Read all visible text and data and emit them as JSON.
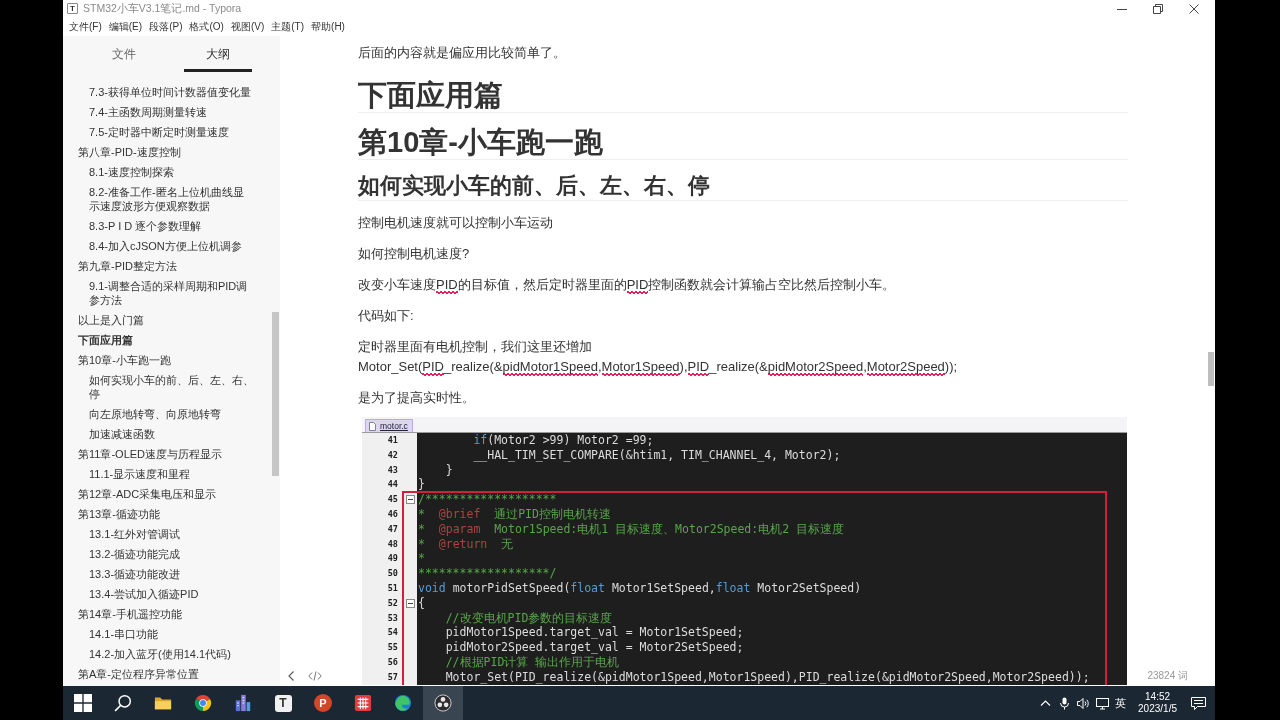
{
  "window": {
    "icon": "T",
    "title": "STM32小车V3.1笔记.md - Typora"
  },
  "menu": [
    "文件(F)",
    "编辑(E)",
    "段落(P)",
    "格式(O)",
    "视图(V)",
    "主题(T)",
    "帮助(H)"
  ],
  "sidebar": {
    "tabs": [
      {
        "label": "文件",
        "selected": false
      },
      {
        "label": "大纲",
        "selected": true
      }
    ],
    "outline": [
      {
        "children": [
          {
            "title": "7.3-获得单位时间计数器值变化量",
            "selected": false
          },
          {
            "title": "7.4-主函数周期测量转速",
            "selected": false
          },
          {
            "title": "7.5-定时器中断定时测量速度",
            "selected": false
          }
        ]
      },
      {
        "title": "第八章-PID-速度控制",
        "selected": false,
        "children": [
          {
            "title": "8.1-速度控制探索",
            "selected": false
          },
          {
            "title": "8.2-准备工作-匿名上位机曲线显示速度波形方便观察数据",
            "selected": false
          },
          {
            "title": "8.3-P I D 逐个参数理解",
            "selected": false
          },
          {
            "title": "8.4-加入cJSON方便上位机调参",
            "selected": false
          }
        ]
      },
      {
        "title": "第九章-PID整定方法",
        "selected": false,
        "children": [
          {
            "title": "9.1-调整合适的采样周期和PID调参方法",
            "selected": false
          }
        ]
      },
      {
        "title": "以上是入门篇",
        "selected": false
      },
      {
        "title": "下面应用篇",
        "selected": true
      },
      {
        "title": "第10章-小车跑一跑",
        "selected": false,
        "children": [
          {
            "title": "如何实现小车的前、后、左、右、停",
            "selected": false
          },
          {
            "title": "向左原地转弯、向原地转弯",
            "selected": false
          },
          {
            "title": "加速减速函数",
            "selected": false
          }
        ]
      },
      {
        "title": "第11章-OLED速度与历程显示",
        "selected": false,
        "children": [
          {
            "title": "11.1-显示速度和里程",
            "selected": false
          }
        ]
      },
      {
        "title": "第12章-ADC采集电压和显示",
        "selected": false
      },
      {
        "title": "第13章-循迹功能",
        "selected": false,
        "children": [
          {
            "title": "13.1-红外对管调试",
            "selected": false
          },
          {
            "title": "13.2-循迹功能完成",
            "selected": false
          },
          {
            "title": "13.3-循迹功能改进",
            "selected": false
          },
          {
            "title": "13.4-尝试加入循迹PID",
            "selected": false
          }
        ]
      },
      {
        "title": "第14章-手机遥控功能",
        "selected": false,
        "children": [
          {
            "title": "14.1-串口功能",
            "selected": false
          },
          {
            "title": "14.2-加入蓝牙(使用14.1代码)",
            "selected": false
          }
        ]
      },
      {
        "title": "第A章-定位程序异常位置",
        "selected": false
      }
    ]
  },
  "document": {
    "blocks": [
      {
        "kind": "paragraph",
        "runs": [
          {
            "text": "后面的内容就是偏应用比较简单了。",
            "misspelled": false
          }
        ]
      },
      {
        "kind": "heading1",
        "text": "下面应用篇"
      },
      {
        "kind": "heading1",
        "text": "第10章-小车跑一跑"
      },
      {
        "kind": "heading2",
        "text": "如何实现小车的前、后、左、右、停"
      },
      {
        "kind": "paragraph",
        "runs": [
          {
            "text": "控制电机速度就可以控制小车运动",
            "misspelled": false
          }
        ]
      },
      {
        "kind": "paragraph",
        "runs": [
          {
            "text": "如何控制电机速度?",
            "misspelled": false
          }
        ]
      },
      {
        "kind": "paragraph",
        "runs": [
          {
            "text": "改变小车速度",
            "misspelled": false
          },
          {
            "text": "PID",
            "misspelled": true
          },
          {
            "text": "的目标值，然后定时器里面的",
            "misspelled": false
          },
          {
            "text": "PID",
            "misspelled": true
          },
          {
            "text": "控制函数就会计算输占空比然后控制小车。",
            "misspelled": false
          }
        ]
      },
      {
        "kind": "paragraph",
        "runs": [
          {
            "text": "代码如下:",
            "misspelled": false
          }
        ]
      },
      {
        "kind": "paragraph",
        "runs": [
          {
            "text": "定时器里面有电机控制，我们这里还增加Motor_Set(",
            "misspelled": false
          },
          {
            "text": "PID",
            "misspelled": true
          },
          {
            "text": "_realize(&",
            "misspelled": false
          },
          {
            "text": "pidMotor1Speed",
            "misspelled": true
          },
          {
            "text": ",",
            "misspelled": false
          },
          {
            "text": "Motor1Speed",
            "misspelled": true
          },
          {
            "text": "),",
            "misspelled": false
          },
          {
            "text": "PID",
            "misspelled": true
          },
          {
            "text": "_realize(&",
            "misspelled": false
          },
          {
            "text": "pidMotor2Speed",
            "misspelled": true
          },
          {
            "text": ",",
            "misspelled": false
          },
          {
            "text": "Motor2Speed",
            "misspelled": true
          },
          {
            "text": "));",
            "misspelled": false
          }
        ]
      },
      {
        "kind": "paragraph",
        "runs": [
          {
            "text": "是为了提高实时性。",
            "misspelled": false
          }
        ]
      },
      {
        "kind": "code_image",
        "tab": "motor.c",
        "lines": [
          {
            "number": "41",
            "fold": false,
            "runs": [
              {
                "kind": "keyword",
                "text": "        if"
              },
              {
                "kind": "plain",
                "text": "(Motor2 >99) Motor2 =99;"
              }
            ]
          },
          {
            "number": "42",
            "fold": false,
            "runs": [
              {
                "kind": "plain",
                "text": "        __HAL_TIM_SET_COMPARE(&htim1, TIM_CHANNEL_4, Motor2);"
              }
            ]
          },
          {
            "number": "43",
            "fold": false,
            "runs": [
              {
                "kind": "plain",
                "text": "    }"
              }
            ]
          },
          {
            "number": "44",
            "fold": false,
            "runs": [
              {
                "kind": "plain",
                "text": "}"
              }
            ]
          },
          {
            "number": "45",
            "fold": true,
            "runs": [
              {
                "kind": "comment",
                "text": "/*******************"
              }
            ]
          },
          {
            "number": "46",
            "fold": false,
            "runs": [
              {
                "kind": "comment",
                "text": "*  "
              },
              {
                "kind": "tag",
                "text": "@brief"
              },
              {
                "kind": "comment",
                "text": "  通过PID控制电机转速"
              }
            ]
          },
          {
            "number": "47",
            "fold": false,
            "runs": [
              {
                "kind": "comment",
                "text": "*  "
              },
              {
                "kind": "tag",
                "text": "@param"
              },
              {
                "kind": "comment",
                "text": "  Motor1Speed:电机1 目标速度、Motor2Speed:电机2 目标速度"
              }
            ]
          },
          {
            "number": "48",
            "fold": false,
            "runs": [
              {
                "kind": "comment",
                "text": "*  "
              },
              {
                "kind": "tag",
                "text": "@return"
              },
              {
                "kind": "comment",
                "text": "  无"
              }
            ]
          },
          {
            "number": "49",
            "fold": false,
            "runs": [
              {
                "kind": "comment",
                "text": "*"
              }
            ]
          },
          {
            "number": "50",
            "fold": false,
            "runs": [
              {
                "kind": "comment",
                "text": "*******************/"
              }
            ]
          },
          {
            "number": "51",
            "fold": false,
            "runs": [
              {
                "kind": "keyword",
                "text": "void"
              },
              {
                "kind": "plain",
                "text": " motorPidSetSpeed("
              },
              {
                "kind": "keyword",
                "text": "float"
              },
              {
                "kind": "plain",
                "text": " Motor1SetSpeed,"
              },
              {
                "kind": "keyword",
                "text": "float"
              },
              {
                "kind": "plain",
                "text": " Motor2SetSpeed)"
              }
            ]
          },
          {
            "number": "52",
            "fold": true,
            "runs": [
              {
                "kind": "plain",
                "text": "{"
              }
            ]
          },
          {
            "number": "53",
            "fold": false,
            "runs": [
              {
                "kind": "comment",
                "text": "    //改变电机PID参数的目标速度"
              }
            ]
          },
          {
            "number": "54",
            "fold": false,
            "runs": [
              {
                "kind": "plain",
                "text": "    pidMotor1Speed.target_val = Motor1SetSpeed;"
              }
            ]
          },
          {
            "number": "55",
            "fold": false,
            "runs": [
              {
                "kind": "plain",
                "text": "    pidMotor2Speed.target_val = Motor2SetSpeed;"
              }
            ]
          },
          {
            "number": "56",
            "fold": false,
            "runs": [
              {
                "kind": "comment",
                "text": "    //根据PID计算 输出作用于电机"
              }
            ]
          },
          {
            "number": "57",
            "fold": false,
            "runs": [
              {
                "kind": "plain",
                "text": "    Motor_Set(PID_realize(&pidMotor1Speed,Motor1Speed),PID_realize(&pidMotor2Speed,Motor2Speed));"
              }
            ]
          }
        ]
      }
    ]
  },
  "footer": {
    "word_count": "23824 词"
  },
  "taskbar": {
    "apps": [
      {
        "kind": "folder",
        "selected": false
      },
      {
        "kind": "wheel",
        "selected": false
      },
      {
        "kind": "buildings",
        "selected": false
      },
      {
        "kind": "tile",
        "glyph": "T",
        "selected": false
      },
      {
        "kind": "disc",
        "glyph": "P",
        "selected": false
      },
      {
        "kind": "grid",
        "selected": false
      },
      {
        "kind": "swirl",
        "selected": false
      },
      {
        "kind": "lens",
        "selected": true
      }
    ],
    "input_method": "英",
    "time": "14:52",
    "date": "2023/1/5"
  }
}
